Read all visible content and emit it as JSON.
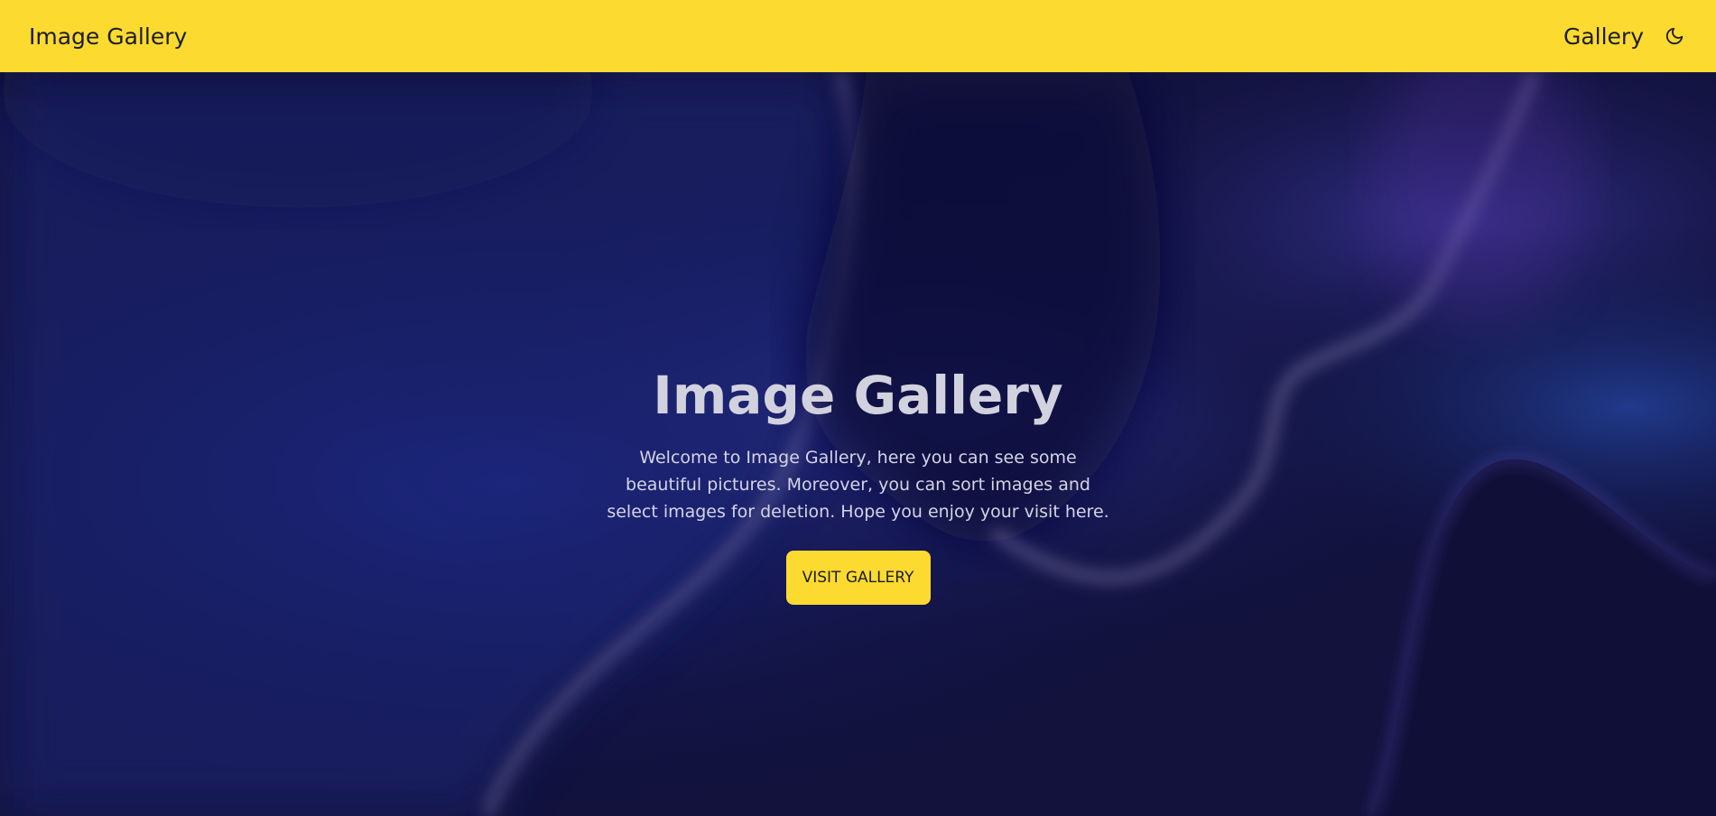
{
  "navbar": {
    "brand": "Image Gallery",
    "links": [
      {
        "label": "Gallery"
      }
    ],
    "theme_icon": "moon-icon"
  },
  "hero": {
    "title": "Image Gallery",
    "description": "Welcome to Image Gallery, here you can see some beautiful pictures. Moreover, you can sort images and select images for deletion. Hope you enjoy your visit here.",
    "button_label": "VISIT GALLERY"
  },
  "colors": {
    "accent": "#FCDA30",
    "background": "#12123d",
    "text_dark": "#1c1c28",
    "hero_text": "#d2d2df"
  }
}
